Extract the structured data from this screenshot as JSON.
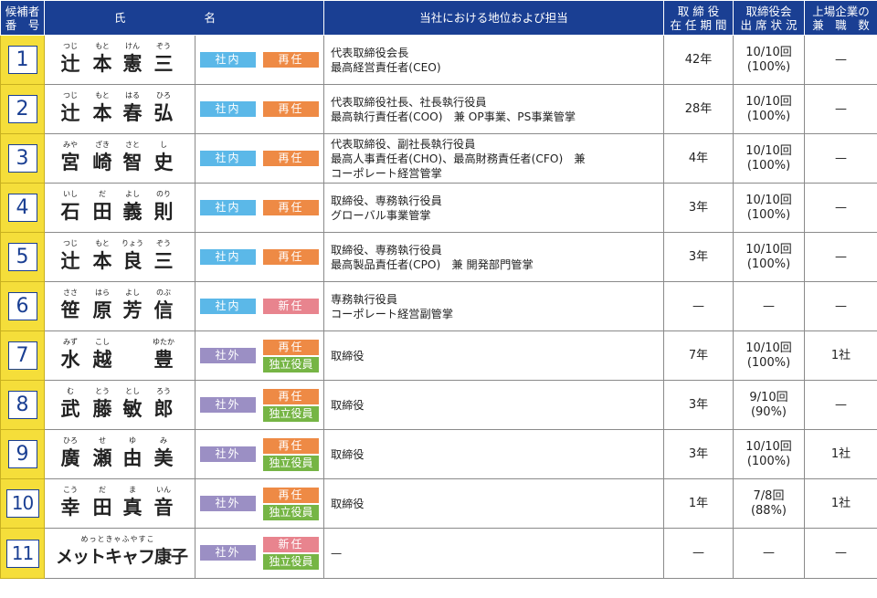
{
  "headers": {
    "no": [
      "候補者",
      "番　号"
    ],
    "name_left": "氏",
    "name_right": "名",
    "position": "当社における地位および担当",
    "tenure": [
      "取 締 役",
      "在 任 期 間"
    ],
    "attendance": [
      "取締役会",
      "出 席 状 況"
    ],
    "concurrent": [
      "上場企業の",
      "兼　職　数"
    ]
  },
  "rows": [
    {
      "no": "1",
      "ruby": [
        "つじ",
        "もと",
        "けん",
        "ぞう"
      ],
      "kanji": [
        "辻",
        "本",
        "憲",
        "三"
      ],
      "type": "社内",
      "status": [
        "再任"
      ],
      "position": [
        "代表取締役会長",
        "最高経営責任者(CEO)"
      ],
      "tenure": "42年",
      "attendance": [
        "10/10回",
        "(100%)"
      ],
      "concurrent": "—"
    },
    {
      "no": "2",
      "ruby": [
        "つじ",
        "もと",
        "はる",
        "ひろ"
      ],
      "kanji": [
        "辻",
        "本",
        "春",
        "弘"
      ],
      "type": "社内",
      "status": [
        "再任"
      ],
      "position": [
        "代表取締役社長、社長執行役員",
        "最高執行責任者(COO)　兼 OP事業、PS事業管掌"
      ],
      "tenure": "28年",
      "attendance": [
        "10/10回",
        "(100%)"
      ],
      "concurrent": "—"
    },
    {
      "no": "3",
      "ruby": [
        "みや",
        "ざき",
        "さと",
        "し"
      ],
      "kanji": [
        "宮",
        "崎",
        "智",
        "史"
      ],
      "type": "社内",
      "status": [
        "再任"
      ],
      "position": [
        "代表取締役、副社長執行役員",
        "最高人事責任者(CHO)、最高財務責任者(CFO)　兼",
        "コーポレート経営管掌"
      ],
      "tenure": "4年",
      "attendance": [
        "10/10回",
        "(100%)"
      ],
      "concurrent": "—"
    },
    {
      "no": "4",
      "ruby": [
        "いし",
        "だ",
        "よし",
        "のり"
      ],
      "kanji": [
        "石",
        "田",
        "義",
        "則"
      ],
      "type": "社内",
      "status": [
        "再任"
      ],
      "position": [
        "取締役、専務執行役員",
        "グローバル事業管掌"
      ],
      "tenure": "3年",
      "attendance": [
        "10/10回",
        "(100%)"
      ],
      "concurrent": "—"
    },
    {
      "no": "5",
      "ruby": [
        "つじ",
        "もと",
        "りょう",
        "ぞう"
      ],
      "kanji": [
        "辻",
        "本",
        "良",
        "三"
      ],
      "type": "社内",
      "status": [
        "再任"
      ],
      "position": [
        "取締役、専務執行役員",
        "最高製品責任者(CPO)　兼 開発部門管掌"
      ],
      "tenure": "3年",
      "attendance": [
        "10/10回",
        "(100%)"
      ],
      "concurrent": "—"
    },
    {
      "no": "6",
      "ruby": [
        "ささ",
        "はら",
        "よし",
        "のぶ"
      ],
      "kanji": [
        "笹",
        "原",
        "芳",
        "信"
      ],
      "type": "社内",
      "status": [
        "新任"
      ],
      "position": [
        "専務執行役員",
        "コーポレート経営副管掌"
      ],
      "tenure": "—",
      "attendance": [
        "—"
      ],
      "concurrent": "—"
    },
    {
      "no": "7",
      "ruby": [
        "みず",
        "こし",
        "",
        "ゆたか"
      ],
      "kanji": [
        "水",
        "越",
        "",
        "豊"
      ],
      "type": "社外",
      "status": [
        "再任",
        "独立役員"
      ],
      "position": [
        "取締役"
      ],
      "tenure": "7年",
      "attendance": [
        "10/10回",
        "(100%)"
      ],
      "concurrent": "1社"
    },
    {
      "no": "8",
      "ruby": [
        "む",
        "とう",
        "とし",
        "ろう"
      ],
      "kanji": [
        "武",
        "藤",
        "敏",
        "郎"
      ],
      "type": "社外",
      "status": [
        "再任",
        "独立役員"
      ],
      "position": [
        "取締役"
      ],
      "tenure": "3年",
      "attendance": [
        "9/10回",
        "(90%)"
      ],
      "concurrent": "—"
    },
    {
      "no": "9",
      "ruby": [
        "ひろ",
        "せ",
        "ゆ",
        "み"
      ],
      "kanji": [
        "廣",
        "瀬",
        "由",
        "美"
      ],
      "type": "社外",
      "status": [
        "再任",
        "独立役員"
      ],
      "position": [
        "取締役"
      ],
      "tenure": "3年",
      "attendance": [
        "10/10回",
        "(100%)"
      ],
      "concurrent": "1社"
    },
    {
      "no": "10",
      "ruby": [
        "こう",
        "だ",
        "ま",
        "いん"
      ],
      "kanji": [
        "幸",
        "田",
        "真",
        "音"
      ],
      "type": "社外",
      "status": [
        "再任",
        "独立役員"
      ],
      "position": [
        "取締役"
      ],
      "tenure": "1年",
      "attendance": [
        "7/8回",
        "(88%)"
      ],
      "concurrent": "1社"
    },
    {
      "no": "11",
      "ruby_line": "めっときゃふやすこ",
      "name_line": "メットキャフ康子",
      "type": "社外",
      "status": [
        "新任",
        "独立役員"
      ],
      "position": [
        "—"
      ],
      "tenure": "—",
      "attendance": [
        "—"
      ],
      "concurrent": "—"
    }
  ],
  "colors": {
    "header": "#1a3f93",
    "number_cell": "#f5de3a",
    "internal": "#5bb8e8",
    "external": "#9b8fc4",
    "reappoint": "#ee8a45",
    "new": "#e8848e",
    "independent": "#76b545"
  }
}
